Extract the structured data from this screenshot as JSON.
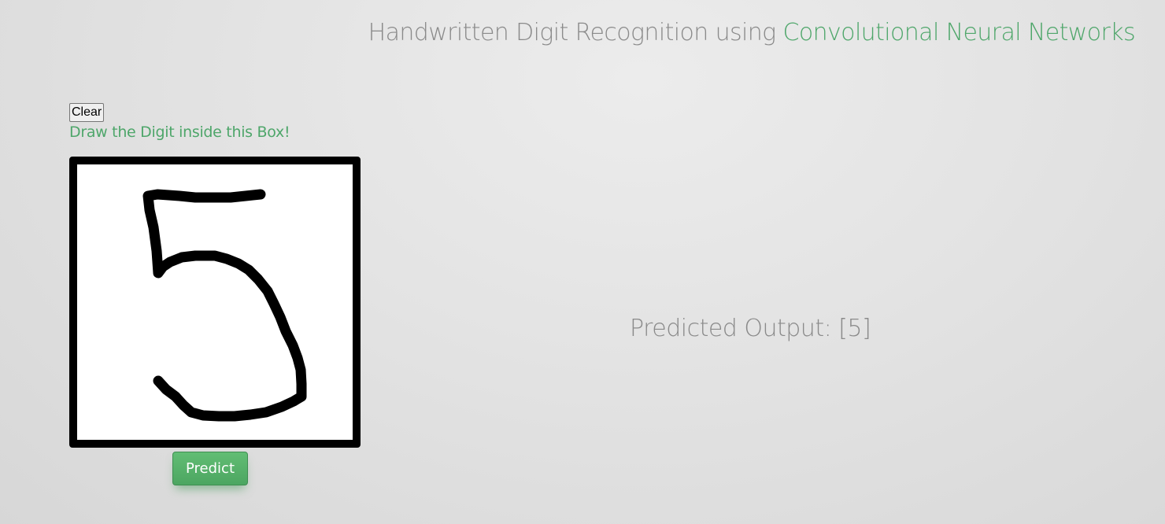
{
  "header": {
    "title_prefix": "Handwritten Digit Recognition using ",
    "title_accent": "Convolutional Neural Networks"
  },
  "controls": {
    "clear_label": "Clear",
    "instruction": "Draw the Digit inside this Box!",
    "predict_label": "Predict"
  },
  "result": {
    "prefix": "Predicted Output: ",
    "value": "[5]"
  },
  "colors": {
    "accent": "#4ea66a",
    "title_gray": "#8a8a8a",
    "stroke": "#000000"
  }
}
